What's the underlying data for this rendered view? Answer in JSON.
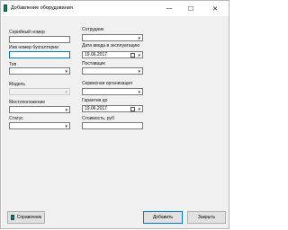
{
  "window": {
    "title": "Добавление оборудования",
    "minimize_glyph": "—",
    "maximize_glyph": "☐",
    "close_glyph": "✕"
  },
  "colors": {
    "focus_border": "#0078d7",
    "body_bg": "#f0f0f0",
    "icon_teal": "#1a7a6e"
  },
  "form": {
    "serial_number": {
      "label": "Серийный номер",
      "value": ""
    },
    "inventory_number": {
      "label": "Инв номер бухгалтерии",
      "value": ""
    },
    "type": {
      "label": "Тип",
      "value": ""
    },
    "model": {
      "label": "Модель",
      "value": ""
    },
    "location": {
      "label": "Местоположение",
      "value": ""
    },
    "status": {
      "label": "Статус",
      "value": ""
    },
    "employee": {
      "label": "Сотрудник",
      "value": ""
    },
    "commission_date": {
      "label": "Дата ввода в эксплуатацию",
      "value": "19.06.2017"
    },
    "supplier": {
      "label": "Поставщик",
      "value": ""
    },
    "service_org": {
      "label": "Сервисная организация",
      "value": ""
    },
    "warranty_until": {
      "label": "Гарантия до",
      "value": "19.06.2017"
    },
    "cost": {
      "label": "Стоимость, руб",
      "value": ""
    }
  },
  "buttons": {
    "reference": "Справочник",
    "add": "Добавить",
    "close": "Закрыть"
  },
  "icons": {
    "dropdown": "▾",
    "calendar": "calendar-icon",
    "app": "book-icon"
  }
}
